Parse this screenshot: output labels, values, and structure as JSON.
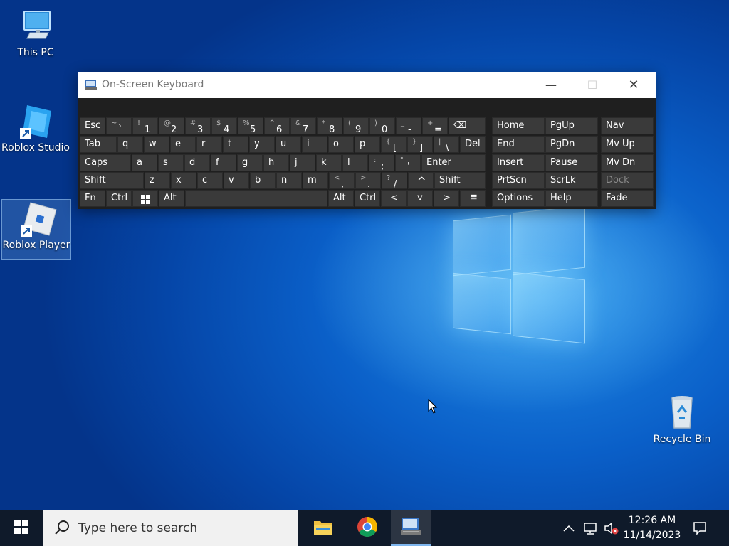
{
  "desktop": {
    "icons": [
      {
        "label": "This PC"
      },
      {
        "label": "Roblox Studio"
      },
      {
        "label": "Roblox Player"
      },
      {
        "label": "Recycle Bin"
      }
    ]
  },
  "osk": {
    "title": "On-Screen Keyboard",
    "controls": {
      "minimize": "—",
      "maximize": "☐",
      "close": "✕"
    },
    "rows": {
      "row1": {
        "esc": "Esc",
        "tilde": {
          "shift": "~",
          "main": "`"
        },
        "k1": {
          "shift": "!",
          "main": "1"
        },
        "k2": {
          "shift": "@",
          "main": "2"
        },
        "k3": {
          "shift": "#",
          "main": "3"
        },
        "k4": {
          "shift": "$",
          "main": "4"
        },
        "k5": {
          "shift": "%",
          "main": "5"
        },
        "k6": {
          "shift": "^",
          "main": "6"
        },
        "k7": {
          "shift": "&",
          "main": "7"
        },
        "k8": {
          "shift": "*",
          "main": "8"
        },
        "k9": {
          "shift": "(",
          "main": "9"
        },
        "k0": {
          "shift": ")",
          "main": "0"
        },
        "minus": {
          "shift": "_",
          "main": "-"
        },
        "equals": {
          "shift": "+",
          "main": "="
        },
        "backspace": "⌫"
      },
      "row2": {
        "tab": "Tab",
        "letters": [
          "q",
          "w",
          "e",
          "r",
          "t",
          "y",
          "u",
          "i",
          "o",
          "p"
        ],
        "lbracket": {
          "shift": "{",
          "main": "["
        },
        "rbracket": {
          "shift": "}",
          "main": "]"
        },
        "backslash": {
          "shift": "|",
          "main": "\\"
        },
        "del": "Del"
      },
      "row3": {
        "caps": "Caps",
        "letters": [
          "a",
          "s",
          "d",
          "f",
          "g",
          "h",
          "j",
          "k",
          "l"
        ],
        "semicolon": {
          "shift": ":",
          "main": ";"
        },
        "quote": {
          "shift": "\"",
          "main": "'"
        },
        "enter": "Enter"
      },
      "row4": {
        "lshift": "Shift",
        "letters": [
          "z",
          "x",
          "c",
          "v",
          "b",
          "n",
          "m"
        ],
        "comma": {
          "shift": "<",
          "main": ","
        },
        "period": {
          "shift": ">",
          "main": "."
        },
        "slash": {
          "shift": "?",
          "main": "/"
        },
        "up": "^",
        "rshift": "Shift"
      },
      "row5": {
        "fn": "Fn",
        "ctrl": "Ctrl",
        "alt": "Alt",
        "alt_r": "Alt",
        "ctrl_r": "Ctrl",
        "left": "<",
        "down": "v",
        "right": ">",
        "menu": "≣"
      }
    },
    "nav": {
      "col1": [
        "Home",
        "End",
        "Insert",
        "PrtScn",
        "Options"
      ],
      "col2": [
        "PgUp",
        "PgDn",
        "Pause",
        "ScrLk",
        "Help"
      ],
      "col3": [
        "Nav",
        "Mv Up",
        "Mv Dn",
        "Dock",
        "Fade"
      ]
    }
  },
  "taskbar": {
    "search_placeholder": "Type here to search",
    "time": "12:26 AM",
    "date": "11/14/2023"
  }
}
